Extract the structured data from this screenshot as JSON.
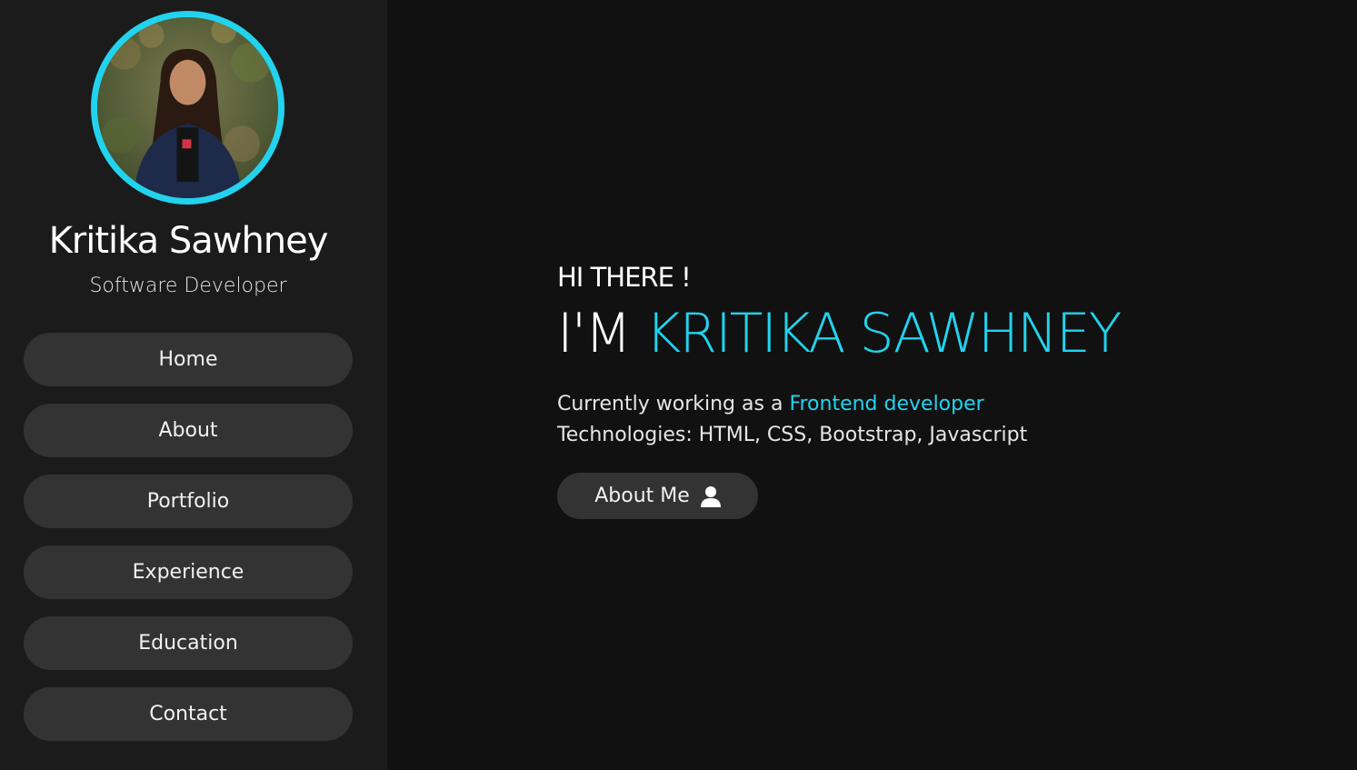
{
  "profile": {
    "name": "Kritika Sawhney",
    "role": "Software Developer"
  },
  "nav": {
    "items": [
      {
        "label": "Home"
      },
      {
        "label": "About"
      },
      {
        "label": "Portfolio"
      },
      {
        "label": "Experience"
      },
      {
        "label": "Education"
      },
      {
        "label": "Contact"
      }
    ]
  },
  "hero": {
    "greeting": "HI THERE !",
    "headline_lead": "I'M",
    "headline_name": "KRITIKA SAWHNEY",
    "line1_prefix": "Currently working as a",
    "line1_highlight": "Frontend developer",
    "line2": "Technologies: HTML, CSS, Bootstrap, Javascript",
    "cta_label": "About Me",
    "cta_icon": "user-icon"
  },
  "colors": {
    "accent": "#22d3ee",
    "sidebar_bg": "#1b1b1b",
    "main_bg": "#111111",
    "button_bg": "#333333"
  }
}
